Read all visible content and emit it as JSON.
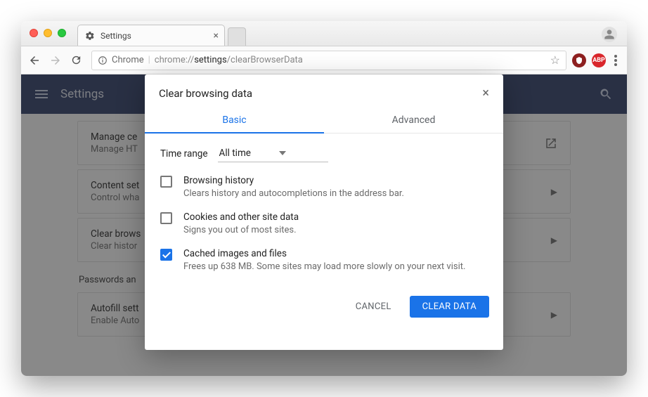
{
  "window": {
    "tab_title": "Settings",
    "tab_icon": "gear-icon"
  },
  "toolbar": {
    "url_scheme": "Chrome",
    "url_prefix": "chrome://",
    "url_host": "settings",
    "url_path": "/clearBrowserData"
  },
  "header": {
    "title": "Settings"
  },
  "background_rows": {
    "row0_title": "Manage ce",
    "row0_sub": "Manage HT",
    "row1_title": "Content set",
    "row1_sub": "Control wha",
    "row2_title": "Clear brows",
    "row2_sub": "Clear histor",
    "section": "Passwords an",
    "row3_title": "Autofill sett",
    "row3_sub": "Enable Auto"
  },
  "dialog": {
    "title": "Clear browsing data",
    "tab_basic": "Basic",
    "tab_advanced": "Advanced",
    "time_label": "Time range",
    "time_value": "All time",
    "items": [
      {
        "title": "Browsing history",
        "sub": "Clears history and autocompletions in the address bar.",
        "checked": false
      },
      {
        "title": "Cookies and other site data",
        "sub": "Signs you out of most sites.",
        "checked": false
      },
      {
        "title": "Cached images and files",
        "sub": "Frees up 638 MB. Some sites may load more slowly on your next visit.",
        "checked": true
      }
    ],
    "cancel": "CANCEL",
    "confirm": "CLEAR DATA"
  }
}
